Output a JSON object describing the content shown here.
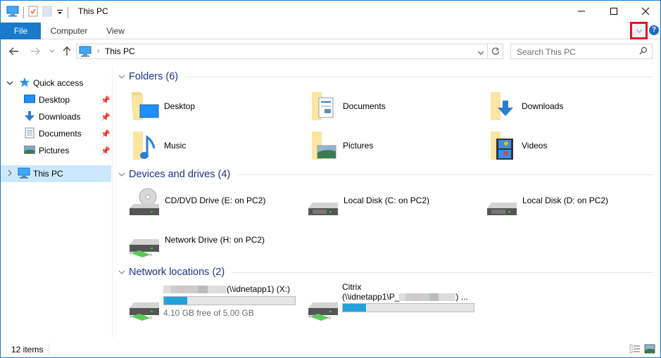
{
  "window": {
    "title": "This PC",
    "controls": {
      "minimize": "minimize",
      "maximize": "maximize",
      "close": "close"
    }
  },
  "quick_access_toolbar": {
    "icons": [
      "computer-icon",
      "properties-icon",
      "new-folder-icon",
      "customize-dropdown-icon"
    ]
  },
  "ribbon": {
    "tabs": [
      {
        "label": "File",
        "active": true
      },
      {
        "label": "Computer"
      },
      {
        "label": "View"
      }
    ],
    "expand_button": "expand-ribbon",
    "help_label": "?",
    "highlight_color": "#e81123"
  },
  "navigation": {
    "back": "back",
    "forward": "forward",
    "recent": "recent-locations",
    "up": "up",
    "address": {
      "crumb": "This PC"
    },
    "search": {
      "placeholder": "Search This PC"
    }
  },
  "sidebar": {
    "quick_access": {
      "label": "Quick access",
      "items": [
        {
          "label": "Desktop",
          "pinned": true
        },
        {
          "label": "Downloads",
          "pinned": true
        },
        {
          "label": "Documents",
          "pinned": true
        },
        {
          "label": "Pictures",
          "pinned": true
        }
      ]
    },
    "this_pc": {
      "label": "This PC",
      "selected": true
    }
  },
  "content": {
    "groups": {
      "folders": {
        "title": "Folders (6)",
        "items": [
          {
            "label": "Desktop",
            "icon": "desktop-folder-icon"
          },
          {
            "label": "Documents",
            "icon": "documents-folder-icon"
          },
          {
            "label": "Downloads",
            "icon": "downloads-folder-icon"
          },
          {
            "label": "Music",
            "icon": "music-folder-icon"
          },
          {
            "label": "Pictures",
            "icon": "pictures-folder-icon"
          },
          {
            "label": "Videos",
            "icon": "videos-folder-icon"
          }
        ]
      },
      "devices": {
        "title": "Devices and drives (4)",
        "items": [
          {
            "label": "CD/DVD Drive (E: on PC2)",
            "icon": "cd-drive-icon"
          },
          {
            "label": "Local Disk (C: on PC2)",
            "icon": "hard-drive-icon"
          },
          {
            "label": "Local Disk (D: on PC2)",
            "icon": "hard-drive-icon"
          },
          {
            "label": "Network Drive (H: on PC2)",
            "icon": "network-drive-icon"
          }
        ]
      },
      "network": {
        "title": "Network locations (2)",
        "items": [
          {
            "label": "(\\\\idnetapp1) (X:)",
            "redacted_prefix": true,
            "usage_fraction": 0.18,
            "free_text": "4.10 GB free of 5.00 GB"
          },
          {
            "label_line1": "Citrix",
            "label_line2_prefix": "(\\\\idnetapp1\\P_",
            "label_line2_suffix": ") ...",
            "redacted_middle": true,
            "usage_fraction": 0.18
          }
        ]
      }
    }
  },
  "status_bar": {
    "item_count": "12 items",
    "views": [
      "details-view",
      "large-icons-view"
    ]
  }
}
